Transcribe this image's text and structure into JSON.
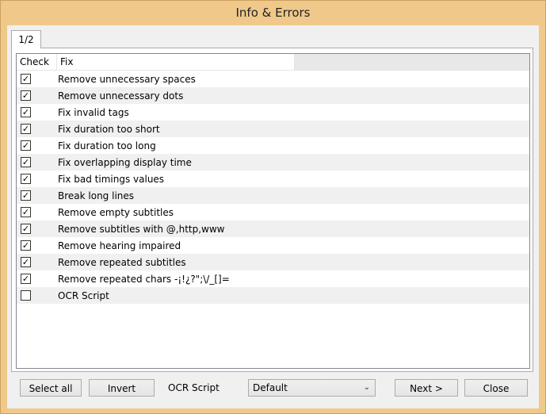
{
  "window": {
    "title": "Info & Errors"
  },
  "tabs": [
    {
      "label": "1/2"
    }
  ],
  "list": {
    "columns": [
      "Check",
      "Fix"
    ],
    "rows": [
      {
        "checked": true,
        "label": "Remove unnecessary spaces"
      },
      {
        "checked": true,
        "label": "Remove unnecessary dots"
      },
      {
        "checked": true,
        "label": "Fix invalid tags"
      },
      {
        "checked": true,
        "label": "Fix duration too short"
      },
      {
        "checked": true,
        "label": "Fix duration too long"
      },
      {
        "checked": true,
        "label": "Fix overlapping display time"
      },
      {
        "checked": true,
        "label": "Fix bad timings values"
      },
      {
        "checked": true,
        "label": "Break long lines"
      },
      {
        "checked": true,
        "label": "Remove empty subtitles"
      },
      {
        "checked": true,
        "label": "Remove subtitles with @,http,www"
      },
      {
        "checked": true,
        "label": "Remove hearing impaired"
      },
      {
        "checked": true,
        "label": "Remove repeated subtitles"
      },
      {
        "checked": true,
        "label": "Remove repeated chars -¡!¿?\";\\/_[]="
      },
      {
        "checked": false,
        "label": "OCR Script"
      }
    ]
  },
  "footer": {
    "select_all": "Select all",
    "invert": "Invert",
    "ocr_label": "OCR Script",
    "ocr_select_value": "Default",
    "next": "Next >",
    "close": "Close"
  },
  "colors": {
    "title_bar": "#f0c98a",
    "client": "#f0f0f0",
    "row_alt": "#f0f0f0"
  }
}
